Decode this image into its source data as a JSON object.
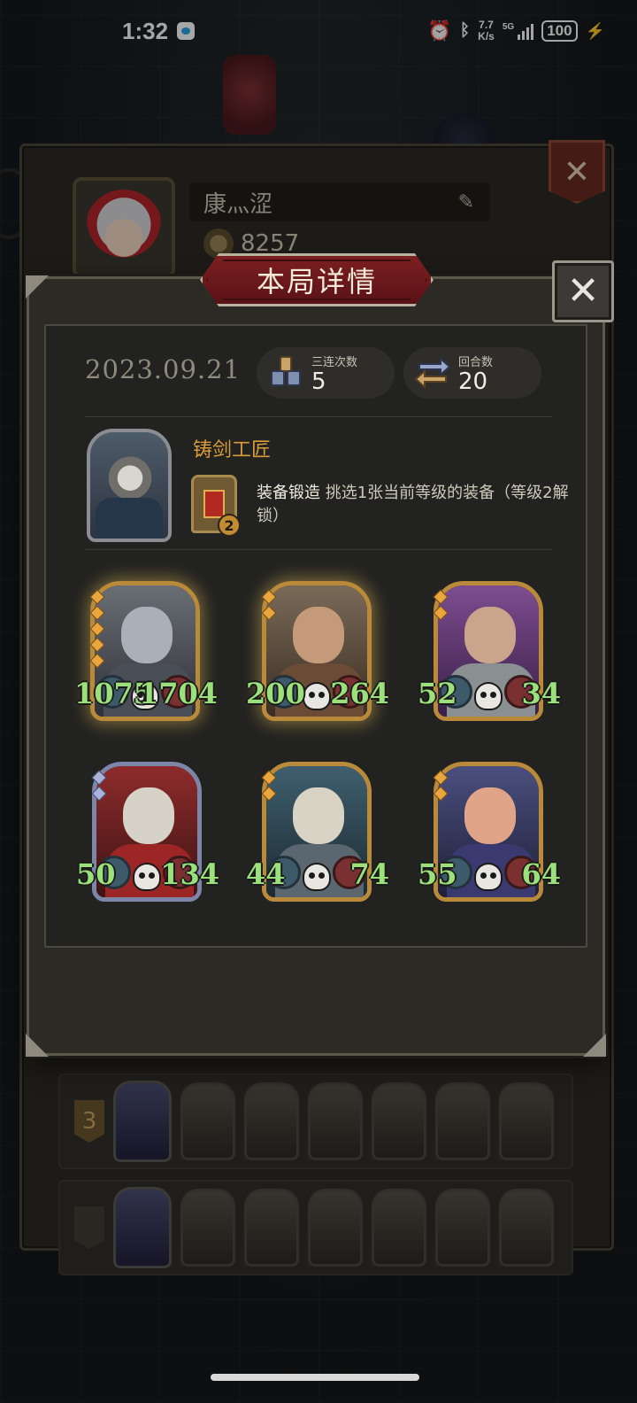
{
  "status_bar": {
    "time": "1:32",
    "net_speed_top": "7.7",
    "net_speed_bottom": "K/s",
    "network": "5G",
    "battery": "100"
  },
  "profile": {
    "name": "康灬涩",
    "coins": "8257"
  },
  "history": {
    "rows": [
      {
        "rank": "3"
      },
      {
        "rank": ""
      }
    ]
  },
  "dialog": {
    "title": "本局详情",
    "date": "2023.09.21",
    "triple_label": "三连次数",
    "triple_value": "5",
    "rounds_label": "回合数",
    "rounds_value": "20",
    "hero": {
      "name": "铸剑工匠",
      "skill_level": "2",
      "skill_name": "装备锻造",
      "skill_desc": " 挑选1张当前等级的装备（等级2解锁）"
    },
    "units": [
      {
        "name": "armored-knight",
        "attack": "1075",
        "health": "1704",
        "frame": "gold",
        "stars": 5
      },
      {
        "name": "bald-brute",
        "attack": "200",
        "health": "264",
        "frame": "gold",
        "stars": 2
      },
      {
        "name": "bearded-warrior",
        "attack": "52",
        "health": "34",
        "frame": "bronze",
        "stars": 2
      },
      {
        "name": "red-helmet-warrior",
        "attack": "50",
        "health": "134",
        "frame": "silver",
        "stars": 2
      },
      {
        "name": "hooded-monk",
        "attack": "44",
        "health": "74",
        "frame": "bronze",
        "stars": 2
      },
      {
        "name": "purple-soldier",
        "attack": "55",
        "health": "64",
        "frame": "bronze",
        "stars": 2
      }
    ]
  },
  "colors": {
    "accent_gold": "#d99a3a",
    "stat_green": "#9be07b",
    "title_red": "#7c1f22"
  }
}
